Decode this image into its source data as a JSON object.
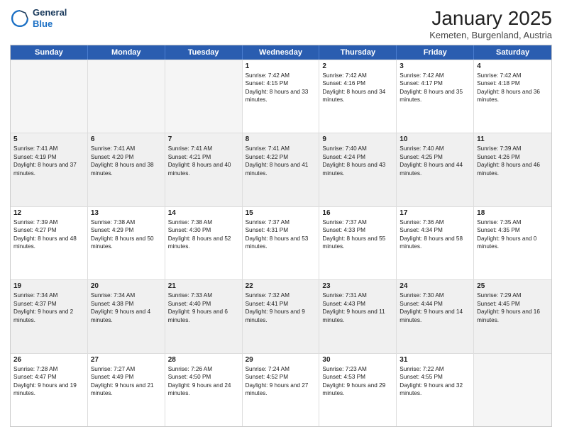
{
  "header": {
    "logo_line1": "General",
    "logo_line2": "Blue",
    "title": "January 2025",
    "subtitle": "Kemeten, Burgenland, Austria"
  },
  "weekdays": [
    "Sunday",
    "Monday",
    "Tuesday",
    "Wednesday",
    "Thursday",
    "Friday",
    "Saturday"
  ],
  "rows": [
    [
      {
        "day": "",
        "info": "",
        "empty": true
      },
      {
        "day": "",
        "info": "",
        "empty": true
      },
      {
        "day": "",
        "info": "",
        "empty": true
      },
      {
        "day": "1",
        "info": "Sunrise: 7:42 AM\nSunset: 4:15 PM\nDaylight: 8 hours and 33 minutes."
      },
      {
        "day": "2",
        "info": "Sunrise: 7:42 AM\nSunset: 4:16 PM\nDaylight: 8 hours and 34 minutes."
      },
      {
        "day": "3",
        "info": "Sunrise: 7:42 AM\nSunset: 4:17 PM\nDaylight: 8 hours and 35 minutes."
      },
      {
        "day": "4",
        "info": "Sunrise: 7:42 AM\nSunset: 4:18 PM\nDaylight: 8 hours and 36 minutes."
      }
    ],
    [
      {
        "day": "5",
        "info": "Sunrise: 7:41 AM\nSunset: 4:19 PM\nDaylight: 8 hours and 37 minutes.",
        "shaded": true
      },
      {
        "day": "6",
        "info": "Sunrise: 7:41 AM\nSunset: 4:20 PM\nDaylight: 8 hours and 38 minutes.",
        "shaded": true
      },
      {
        "day": "7",
        "info": "Sunrise: 7:41 AM\nSunset: 4:21 PM\nDaylight: 8 hours and 40 minutes.",
        "shaded": true
      },
      {
        "day": "8",
        "info": "Sunrise: 7:41 AM\nSunset: 4:22 PM\nDaylight: 8 hours and 41 minutes.",
        "shaded": true
      },
      {
        "day": "9",
        "info": "Sunrise: 7:40 AM\nSunset: 4:24 PM\nDaylight: 8 hours and 43 minutes.",
        "shaded": true
      },
      {
        "day": "10",
        "info": "Sunrise: 7:40 AM\nSunset: 4:25 PM\nDaylight: 8 hours and 44 minutes.",
        "shaded": true
      },
      {
        "day": "11",
        "info": "Sunrise: 7:39 AM\nSunset: 4:26 PM\nDaylight: 8 hours and 46 minutes.",
        "shaded": true
      }
    ],
    [
      {
        "day": "12",
        "info": "Sunrise: 7:39 AM\nSunset: 4:27 PM\nDaylight: 8 hours and 48 minutes."
      },
      {
        "day": "13",
        "info": "Sunrise: 7:38 AM\nSunset: 4:29 PM\nDaylight: 8 hours and 50 minutes."
      },
      {
        "day": "14",
        "info": "Sunrise: 7:38 AM\nSunset: 4:30 PM\nDaylight: 8 hours and 52 minutes."
      },
      {
        "day": "15",
        "info": "Sunrise: 7:37 AM\nSunset: 4:31 PM\nDaylight: 8 hours and 53 minutes."
      },
      {
        "day": "16",
        "info": "Sunrise: 7:37 AM\nSunset: 4:33 PM\nDaylight: 8 hours and 55 minutes."
      },
      {
        "day": "17",
        "info": "Sunrise: 7:36 AM\nSunset: 4:34 PM\nDaylight: 8 hours and 58 minutes."
      },
      {
        "day": "18",
        "info": "Sunrise: 7:35 AM\nSunset: 4:35 PM\nDaylight: 9 hours and 0 minutes."
      }
    ],
    [
      {
        "day": "19",
        "info": "Sunrise: 7:34 AM\nSunset: 4:37 PM\nDaylight: 9 hours and 2 minutes.",
        "shaded": true
      },
      {
        "day": "20",
        "info": "Sunrise: 7:34 AM\nSunset: 4:38 PM\nDaylight: 9 hours and 4 minutes.",
        "shaded": true
      },
      {
        "day": "21",
        "info": "Sunrise: 7:33 AM\nSunset: 4:40 PM\nDaylight: 9 hours and 6 minutes.",
        "shaded": true
      },
      {
        "day": "22",
        "info": "Sunrise: 7:32 AM\nSunset: 4:41 PM\nDaylight: 9 hours and 9 minutes.",
        "shaded": true
      },
      {
        "day": "23",
        "info": "Sunrise: 7:31 AM\nSunset: 4:43 PM\nDaylight: 9 hours and 11 minutes.",
        "shaded": true
      },
      {
        "day": "24",
        "info": "Sunrise: 7:30 AM\nSunset: 4:44 PM\nDaylight: 9 hours and 14 minutes.",
        "shaded": true
      },
      {
        "day": "25",
        "info": "Sunrise: 7:29 AM\nSunset: 4:45 PM\nDaylight: 9 hours and 16 minutes.",
        "shaded": true
      }
    ],
    [
      {
        "day": "26",
        "info": "Sunrise: 7:28 AM\nSunset: 4:47 PM\nDaylight: 9 hours and 19 minutes."
      },
      {
        "day": "27",
        "info": "Sunrise: 7:27 AM\nSunset: 4:49 PM\nDaylight: 9 hours and 21 minutes."
      },
      {
        "day": "28",
        "info": "Sunrise: 7:26 AM\nSunset: 4:50 PM\nDaylight: 9 hours and 24 minutes."
      },
      {
        "day": "29",
        "info": "Sunrise: 7:24 AM\nSunset: 4:52 PM\nDaylight: 9 hours and 27 minutes."
      },
      {
        "day": "30",
        "info": "Sunrise: 7:23 AM\nSunset: 4:53 PM\nDaylight: 9 hours and 29 minutes."
      },
      {
        "day": "31",
        "info": "Sunrise: 7:22 AM\nSunset: 4:55 PM\nDaylight: 9 hours and 32 minutes."
      },
      {
        "day": "",
        "info": "",
        "empty": true
      }
    ]
  ]
}
